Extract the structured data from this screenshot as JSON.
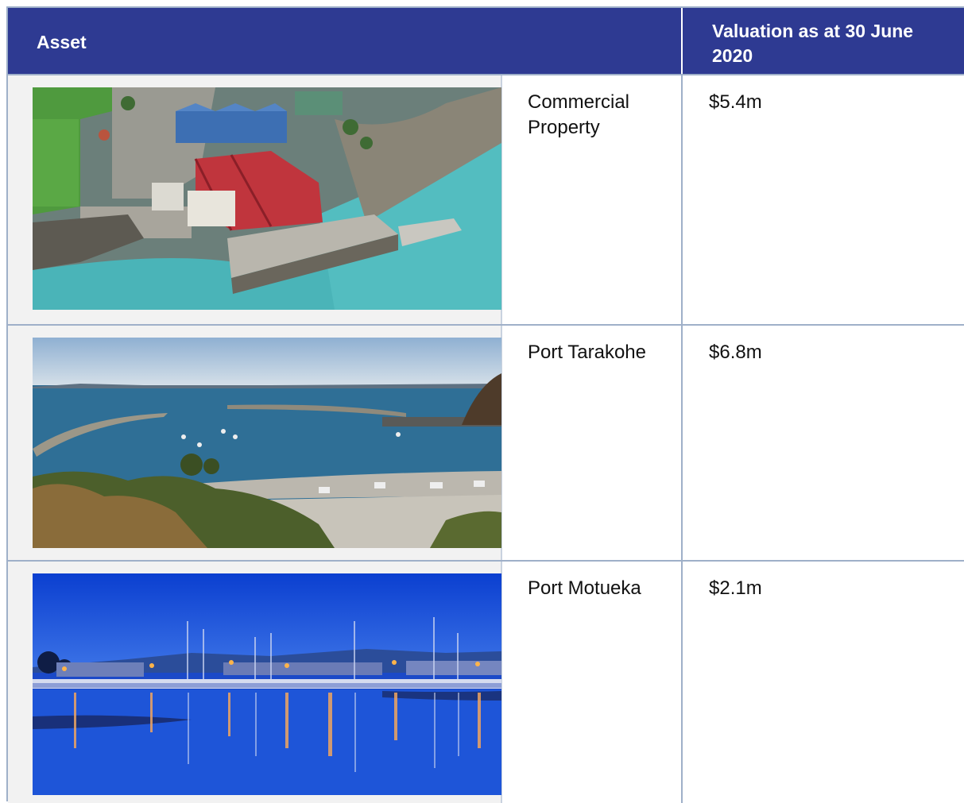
{
  "table": {
    "headers": {
      "asset": "Asset",
      "valuation": "Valuation as at 30 June 2020"
    },
    "rows": [
      {
        "name": "Commercial Property",
        "value": "$5.4m",
        "photo": "aerial-wharf-buildings"
      },
      {
        "name": "Port Tarakohe",
        "value": "$6.8m",
        "photo": "harbour-breakwater"
      },
      {
        "name": "Port Motueka",
        "value": "$2.1m",
        "photo": "marina-at-dusk"
      }
    ]
  },
  "colors": {
    "header_bg": "#2e3a92",
    "border": "#9fb0c9",
    "image_cell_bg": "#f2f2f2"
  }
}
